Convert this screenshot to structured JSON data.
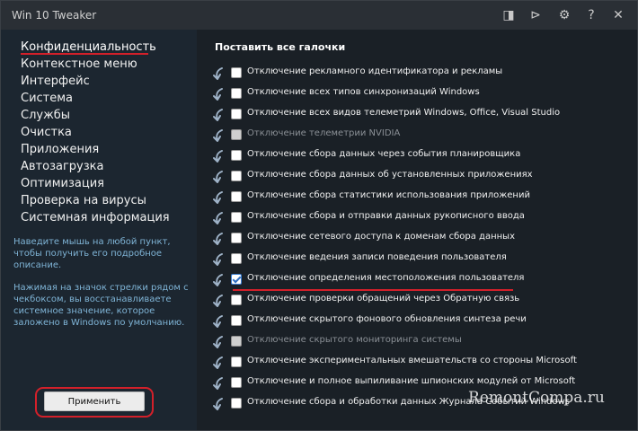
{
  "window": {
    "title": "Win 10 Tweaker"
  },
  "titlebar_icons": [
    "collapse-icon",
    "play-icon",
    "gear-icon",
    "help-icon",
    "close-icon"
  ],
  "titlebar_glyphs": {
    "collapse": "◨",
    "play": "⊳",
    "gear": "⚙",
    "help": "?",
    "close": "✕"
  },
  "sidebar": {
    "items": [
      {
        "label": "Конфиденциальность",
        "active": true
      },
      {
        "label": "Контекстное меню"
      },
      {
        "label": "Интерфейс"
      },
      {
        "label": "Система"
      },
      {
        "label": "Службы"
      },
      {
        "label": "Очистка"
      },
      {
        "label": "Приложения"
      },
      {
        "label": "Автозагрузка"
      },
      {
        "label": "Оптимизация"
      },
      {
        "label": "Проверка на вирусы"
      },
      {
        "label": "Системная информация"
      }
    ],
    "hint1": "Наведите мышь на любой пункт, чтобы получить его подробное описание.",
    "hint2": "Нажимая на значок стрелки рядом с чекбоксом, вы восстанавливаете системное значение, которое заложено в Windows по умолчанию.",
    "apply_label": "Применить"
  },
  "main": {
    "check_all_label": "Поставить все галочки",
    "options": [
      {
        "label": "Отключение рекламного идентификатора и рекламы",
        "checked": false,
        "disabled": false
      },
      {
        "label": "Отключение всех типов синхронизаций Windows",
        "checked": false,
        "disabled": false
      },
      {
        "label": "Отключение всех видов телеметрий Windows, Office, Visual Studio",
        "checked": false,
        "disabled": false
      },
      {
        "label": "Отключение телеметрии NVIDIA",
        "checked": false,
        "disabled": true
      },
      {
        "label": "Отключение сбора данных через события планировщика",
        "checked": false,
        "disabled": false
      },
      {
        "label": "Отключение сбора данных об установленных приложениях",
        "checked": false,
        "disabled": false
      },
      {
        "label": "Отключение сбора статистики использования приложений",
        "checked": false,
        "disabled": false
      },
      {
        "label": "Отключение сбора и отправки данных рукописного ввода",
        "checked": false,
        "disabled": false
      },
      {
        "label": "Отключение сетевого доступа к доменам сбора данных",
        "checked": false,
        "disabled": false
      },
      {
        "label": "Отключение ведения записи поведения пользователя",
        "checked": false,
        "disabled": false
      },
      {
        "label": "Отключение определения местоположения пользователя",
        "checked": true,
        "disabled": false
      },
      {
        "label": "Отключение проверки обращений через Обратную связь",
        "checked": false,
        "disabled": false
      },
      {
        "label": "Отключение скрытого фонового обновления синтеза речи",
        "checked": false,
        "disabled": false
      },
      {
        "label": "Отключение скрытого мониторинга системы",
        "checked": false,
        "disabled": true
      },
      {
        "label": "Отключение экспериментальных вмешательств со стороны Microsoft",
        "checked": false,
        "disabled": false
      },
      {
        "label": "Отключение и полное выпиливание шпионских модулей от Microsoft",
        "checked": false,
        "disabled": false
      },
      {
        "label": "Отключение сбора и обработки данных Журнала Событий Windows",
        "checked": false,
        "disabled": false
      }
    ]
  },
  "watermark": "RemontCompa.ru",
  "colors": {
    "accent_red": "#d3202a",
    "hint_blue": "#7fb4d6",
    "sidebar_bg": "#1c2630",
    "main_bg": "#1a2026"
  }
}
